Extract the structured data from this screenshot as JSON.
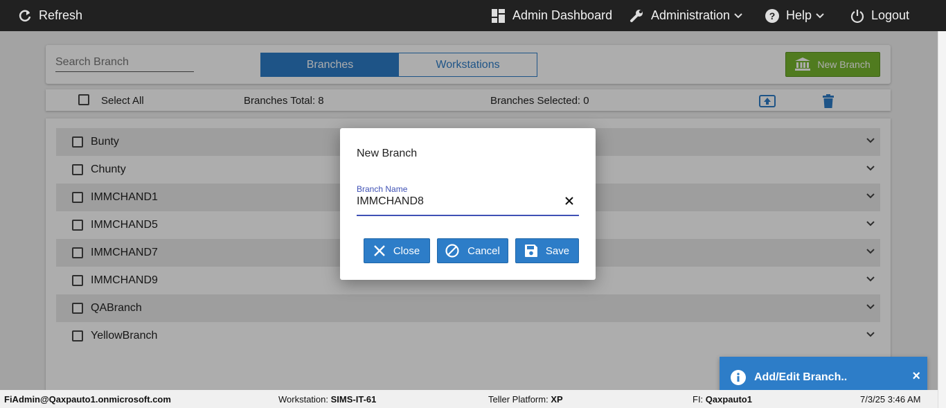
{
  "topbar": {
    "refresh": "Refresh",
    "admin_dashboard": "Admin Dashboard",
    "administration": "Administration",
    "help": "Help",
    "logout": "Logout"
  },
  "toolbar": {
    "search_placeholder": "Search Branch",
    "tabs": [
      {
        "label": "Branches",
        "active": true
      },
      {
        "label": "Workstations",
        "active": false
      }
    ],
    "new_branch": "New Branch"
  },
  "selbar": {
    "select_all": "Select All",
    "total": "Branches Total: 8",
    "selected": "Branches Selected: 0"
  },
  "branches": [
    "Bunty",
    "Chunty",
    "IMMCHAND1",
    "IMMCHAND5",
    "IMMCHAND7",
    "IMMCHAND9",
    "QABranch",
    "YellowBranch"
  ],
  "dialog": {
    "title": "New Branch",
    "field_label": "Branch Name",
    "field_value": "IMMCHAND8",
    "close": "Close",
    "cancel": "Cancel",
    "save": "Save"
  },
  "toast": {
    "text": "Add/Edit Branch..",
    "close": "×"
  },
  "status": {
    "user": "FiAdmin@Qaxpauto1.onmicrosoft.com",
    "workstation_label": "Workstation: ",
    "workstation": "SIMS-IT-61",
    "platform_label": "Teller Platform: ",
    "platform": "XP",
    "fi_label": "FI: ",
    "fi": "Qaxpauto1",
    "time": "7/3/25 3:46 AM"
  },
  "colors": {
    "primary": "#2d7dc8",
    "success": "#77b52e",
    "topbar": "#212121",
    "accent_field": "#3f51b5"
  }
}
